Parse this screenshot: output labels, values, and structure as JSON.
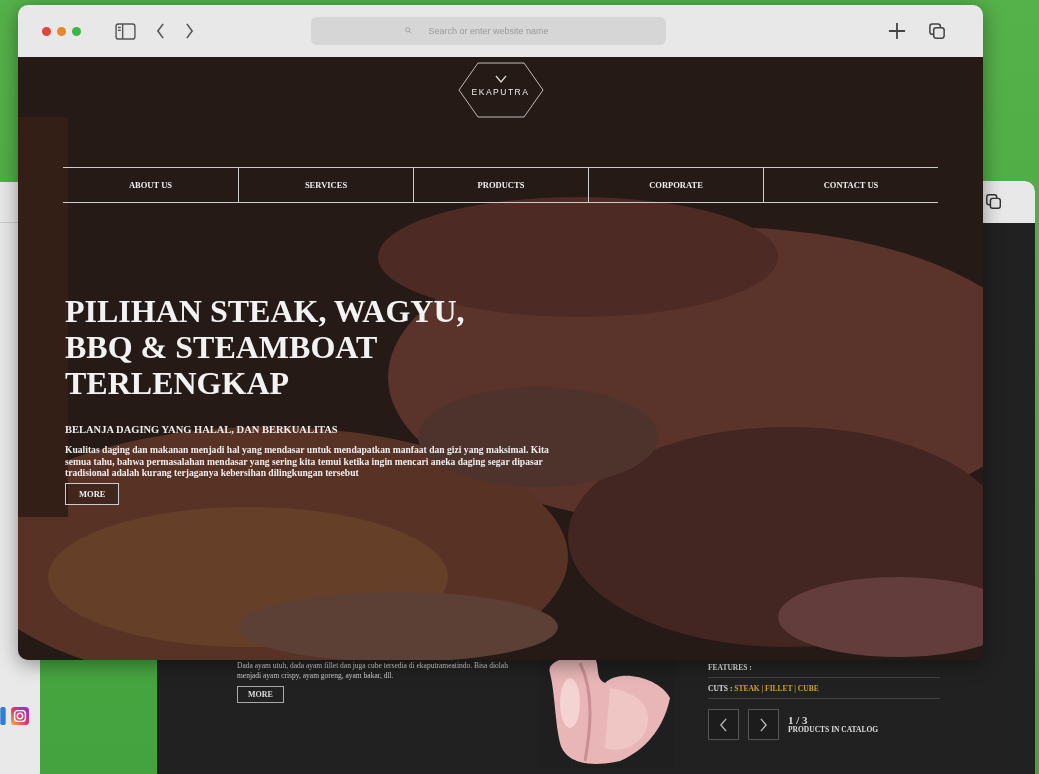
{
  "browser": {
    "address_placeholder": "Search or enter website name"
  },
  "site": {
    "logo": "EKAPUTRA",
    "nav": [
      {
        "label": "ABOUT US"
      },
      {
        "label": "SERVICES"
      },
      {
        "label": "PRODUCTS"
      },
      {
        "label": "CORPORATE"
      },
      {
        "label": "CONTACT US"
      }
    ],
    "hero": {
      "title_lines": [
        "PILIHAN STEAK, WAGYU,",
        "BBQ & STEAMBOAT",
        "TERLENGKAP"
      ],
      "subtitle": "BELANJA DAGING YANG HALAL, DAN BERKUALITAS",
      "body": "Kualitas daging dan makanan menjadi hal yang mendasar untuk mendapatkan manfaat dan gizi yang maksimal. Kita semua tahu, bahwa permasalahan mendasar yang sering kita temui ketika ingin mencari aneka daging segar dipasar tradisional adalah kurang terjaganya kebersihan dilingkungan tersebut",
      "more": "MORE"
    }
  },
  "back_window": {
    "description": "Dada ayam utuh, dada ayam fillet dan juga cube tersedia di ekaputrameatindo. Bisa diolah menjadi ayam crispy, ayam goreng, ayam bakar, dll.",
    "more": "MORE",
    "features_label": "FEATURES :",
    "cuts_label": "CUTS :",
    "cuts": "STEAK | FILLET | CUBE",
    "page": "1 / 3",
    "page_caption": "PRODUCTS IN CATALOG"
  }
}
